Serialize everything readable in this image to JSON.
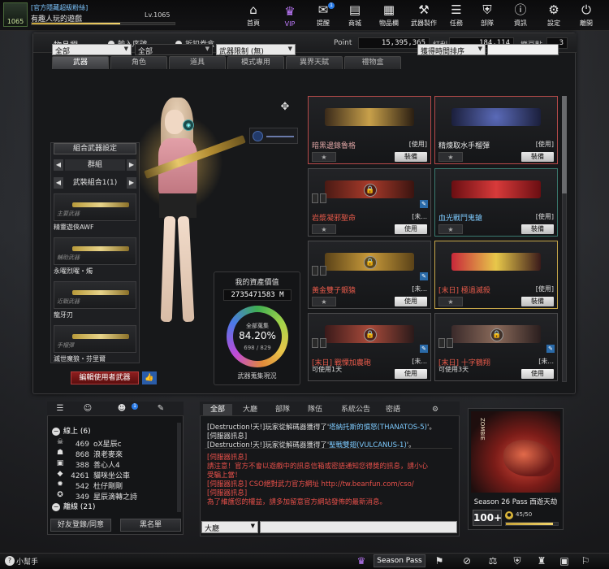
{
  "header": {
    "badge_level": "1065",
    "user_tag": "[官方隱藏超級粉絲]",
    "user_name": "有趣人玩的遊戲",
    "level_label": "Lv.1065",
    "xp_fraction": 0.62,
    "nav": [
      {
        "label": "首頁",
        "icon": "home-icon",
        "glyph": "⌂"
      },
      {
        "label": "VIP",
        "icon": "vip-crown-icon",
        "glyph": "♛"
      },
      {
        "label": "提醒",
        "icon": "bell-icon",
        "glyph": "✉",
        "badge": "1"
      },
      {
        "label": "商城",
        "icon": "shop-icon",
        "glyph": "▤"
      },
      {
        "label": "物品欄",
        "icon": "inventory-icon",
        "glyph": "▦"
      },
      {
        "label": "武器製作",
        "icon": "crafting-icon",
        "glyph": "⚒"
      },
      {
        "label": "任務",
        "icon": "mission-icon",
        "glyph": "☰"
      },
      {
        "label": "部隊",
        "icon": "clan-icon",
        "glyph": "⛨"
      },
      {
        "label": "資訊",
        "icon": "info-icon",
        "glyph": "ⓘ"
      },
      {
        "label": "設定",
        "icon": "gear-icon",
        "glyph": "⚙"
      },
      {
        "label": "離開",
        "icon": "exit-icon",
        "glyph": "⏻"
      }
    ]
  },
  "inventory": {
    "title": "物品欄",
    "enter_code": "輸入序號",
    "coupon_box": "折扣卷盒",
    "stats": [
      {
        "label": "Point",
        "value": "15,395,365"
      },
      {
        "label": "紅利",
        "value": "184,114"
      },
      {
        "label": "樂豆點",
        "value": "3"
      }
    ],
    "tabs": [
      "武器",
      "角色",
      "道具",
      "模式專用",
      "異界天賦",
      "禮物盒"
    ],
    "filters": {
      "f1": "全部",
      "f2": "全部",
      "f3": "武器限制 (無)",
      "sort": "獲得時間排序"
    }
  },
  "loadout": {
    "combo_button": "組合武器設定",
    "group": "群組",
    "set": "武裝組合1(1)",
    "slots": [
      {
        "caption": "主要武器",
        "name": "精靈遊俠AWF"
      },
      {
        "caption": "輔助武器",
        "name": "永曜烈曜・燭"
      },
      {
        "caption": "近戰武器",
        "name": "龍牙刃"
      },
      {
        "caption": "手榴彈",
        "name": "滅世魔狼・芬里爾"
      }
    ],
    "edit_button": "編輯使用者武器"
  },
  "assets": {
    "title": "我的資產價值",
    "value": "2735471583 M",
    "ring_label": "全部蒐集",
    "percent": "84.20%",
    "count": "698 / 829",
    "footer": "武器蒐集現況"
  },
  "weapons": [
    {
      "name": "暗黑邊錄魯格",
      "tag": "[使用]",
      "action": "裝備",
      "color": "#d8a0a0",
      "border": "red",
      "locked": false
    },
    {
      "name": "精煉取水手榴彈",
      "tag": "[使用]",
      "action": "裝備",
      "color": "#e8e8e8",
      "border": "red",
      "locked": false
    },
    {
      "name": "岩漿凝邪聖命",
      "tag": "[未...",
      "action": "使用",
      "color": "#e85a4a",
      "border": "normal",
      "locked": true
    },
    {
      "name": "血光戰鬥鬼鎗",
      "tag": "[使用]",
      "action": "裝備",
      "color": "#7ecbff",
      "border": "teal",
      "locked": false
    },
    {
      "name": "黃金雙子銀猿",
      "tag": "[未...",
      "action": "使用",
      "color": "#e85a4a",
      "border": "normal",
      "locked": true
    },
    {
      "name": "[末日] 極過滅殺",
      "tag": "[使用]",
      "action": "裝備",
      "color": "#e85a4a",
      "border": "gold",
      "locked": false
    },
    {
      "name": "[末日] 戰慄加農砲",
      "tag": "[未...",
      "sub": "可使用1天",
      "action": "使用",
      "color": "#e85a4a",
      "border": "normal",
      "locked": true
    },
    {
      "name": "[末日] 十字鶴翔",
      "tag": "[未...",
      "sub": "可使用3天",
      "action": "使用",
      "color": "#e85a4a",
      "border": "normal",
      "locked": true
    }
  ],
  "social": {
    "tab_badge": "1",
    "online_label": "線上 (6)",
    "offline_label": "離線 (21)",
    "friends": [
      {
        "level": "469",
        "name": "oX星辰c",
        "icon": "skull-icon",
        "glyph": "☠"
      },
      {
        "level": "868",
        "name": "浪老麥來",
        "icon": "ghost-icon",
        "glyph": "☗"
      },
      {
        "level": "388",
        "name": "善心人4",
        "icon": "rank-badge-icon",
        "glyph": "▣"
      },
      {
        "level": "4261",
        "name": "貓咪坐公車",
        "icon": "gem-icon",
        "glyph": "◆"
      },
      {
        "level": "542",
        "name": "杜仔剛剛",
        "icon": "flame-icon",
        "glyph": "✹"
      },
      {
        "level": "349",
        "name": "星辰滴轉之詩",
        "icon": "star-icon",
        "glyph": "✪"
      }
    ],
    "add_friend": "好友登錄/同意",
    "blacklist": "黑名單"
  },
  "chat": {
    "tabs": [
      "全部",
      "大廳",
      "部隊",
      "隊伍",
      "系統公告",
      "密語"
    ],
    "lines_top": [
      {
        "prefix": "[Destruction!天!]玩家從解碼器獲得了'",
        "item": "塔納托斯的憤怒(THANATOS-5)",
        "suffix": "'。"
      },
      {
        "prefix": "[伺服器訊息]",
        "item": "",
        "suffix": ""
      },
      {
        "prefix": "[Destruction!天!]玩家從解碼器獲得了'",
        "item": "聖戰雙翅(VULCANUS-1)",
        "suffix": "'。"
      }
    ],
    "lines_bottom": [
      "[伺服器訊息]",
      "請注意！官方不會以遊戲中的訊息信箱或密語通知您得獎的訊息，請小心",
      "受騙上當！",
      "[伺服器訊息] CSO絕對武力官方網址 http://tw.beanfun.com/cso/",
      "[伺服器訊息]",
      "為了維護您的權益，請多加留意官方網站發佈的最新消息。"
    ],
    "channel": "大廳"
  },
  "season": {
    "art_text": "ZOMBIE",
    "title": "Season 26 Pass 西遊天劫",
    "level": "100+",
    "progress": "45/50",
    "progress_fraction": 0.9
  },
  "taskbar": {
    "helper": "小幫手",
    "season_pass": "Season Pass"
  }
}
